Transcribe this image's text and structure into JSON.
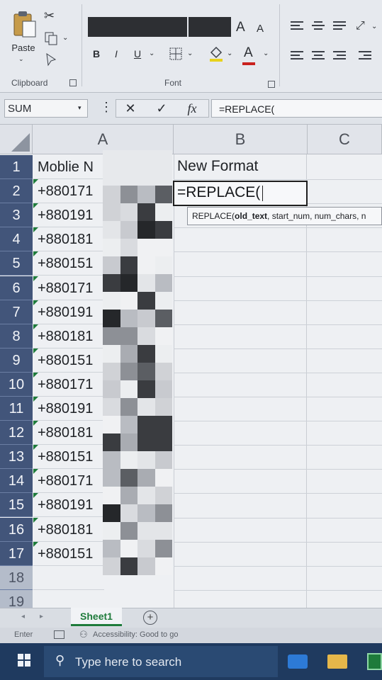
{
  "ribbon": {
    "clipboard": {
      "paste_label": "Paste",
      "group_label": "Clipboard"
    },
    "font": {
      "increase_label": "A",
      "decrease_label": "A",
      "bold": "B",
      "italic": "I",
      "underline": "U",
      "font_color_label": "A",
      "group_label": "Font"
    }
  },
  "formula_bar": {
    "name_box": "SUM",
    "cancel": "✕",
    "enter": "✓",
    "fx": "fx",
    "formula": "=REPLACE("
  },
  "columns": [
    "A",
    "B",
    "C"
  ],
  "rows": [
    {
      "num": "1",
      "a": "Moblie N",
      "b": "New Format"
    },
    {
      "num": "2",
      "a": "+880171",
      "b": "=REPLACE("
    },
    {
      "num": "3",
      "a": "+880191",
      "b": ""
    },
    {
      "num": "4",
      "a": "+880181",
      "b": ""
    },
    {
      "num": "5",
      "a": "+880151",
      "b": ""
    },
    {
      "num": "6",
      "a": "+880171",
      "b": ""
    },
    {
      "num": "7",
      "a": "+880191",
      "b": ""
    },
    {
      "num": "8",
      "a": "+880181",
      "b": ""
    },
    {
      "num": "9",
      "a": "+880151",
      "b": ""
    },
    {
      "num": "10",
      "a": "+880171",
      "b": ""
    },
    {
      "num": "11",
      "a": "+880191",
      "b": ""
    },
    {
      "num": "12",
      "a": "+880181",
      "b": ""
    },
    {
      "num": "13",
      "a": "+880151",
      "b": ""
    },
    {
      "num": "14",
      "a": "+880171",
      "b": ""
    },
    {
      "num": "15",
      "a": "+880191",
      "b": ""
    },
    {
      "num": "16",
      "a": "+880181",
      "b": ""
    },
    {
      "num": "17",
      "a": "+880151",
      "b": ""
    },
    {
      "num": "18",
      "a": "",
      "b": ""
    },
    {
      "num": "19",
      "a": "",
      "b": ""
    }
  ],
  "tooltip": {
    "fn": "REPLACE(",
    "arg1": "old_text",
    "rest": ", start_num, num_chars, n"
  },
  "sheet_tabs": {
    "active": "Sheet1",
    "add": "+"
  },
  "status": {
    "mode": "Enter",
    "accessibility": "Accessibility: Good to go"
  },
  "taskbar": {
    "search_placeholder": "Type here to search"
  }
}
